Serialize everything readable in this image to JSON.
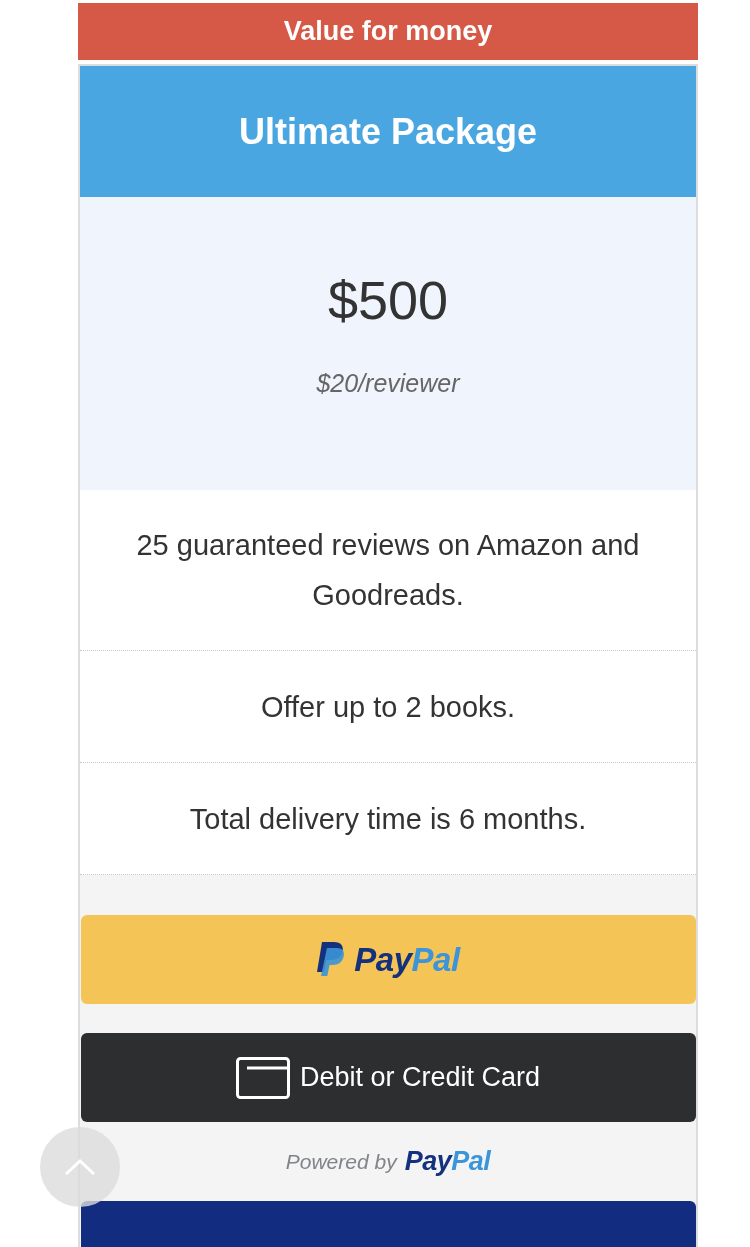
{
  "ribbon": "Value for money",
  "package": {
    "title": "Ultimate Package",
    "price": "$500",
    "unit_price": "$20/reviewer"
  },
  "features": [
    "25 guaranteed reviews on Amazon and Goodreads.",
    "Offer up to 2 books.",
    "Total delivery time is 6 months."
  ],
  "paypal_button": {
    "label_parts": [
      "Pay",
      "Pal"
    ]
  },
  "card_button": {
    "label": "Debit or Credit Card"
  },
  "powered_by": {
    "text": "Powered by",
    "brand_parts": [
      "Pay",
      "Pal"
    ]
  }
}
